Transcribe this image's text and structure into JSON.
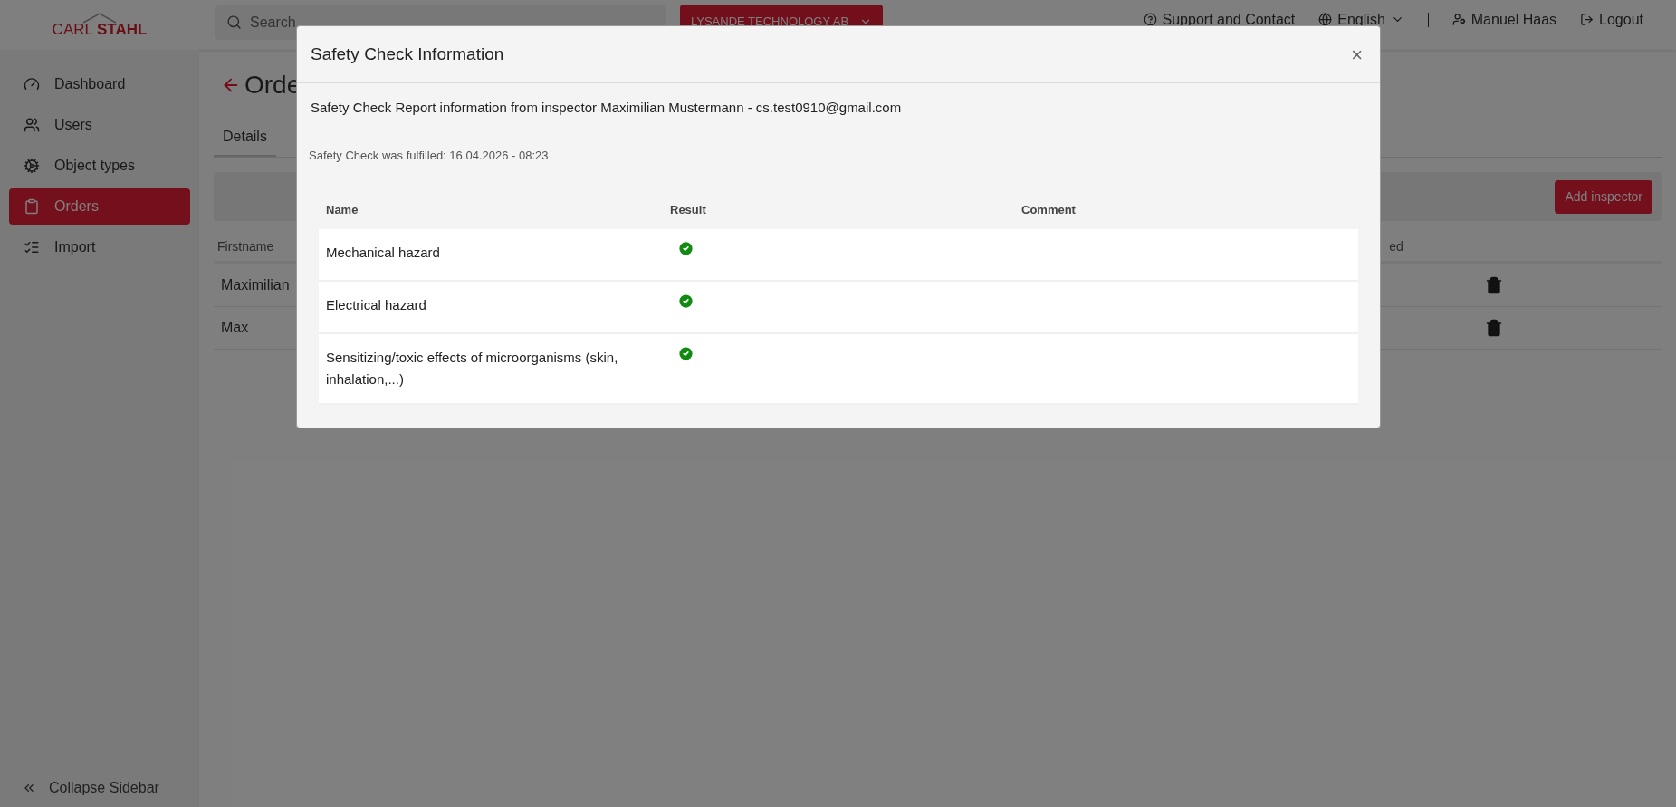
{
  "header": {
    "logo": {
      "first": "CARL",
      "second": "STAHL"
    },
    "search": {
      "placeholder": "Search"
    },
    "company": "LYSANDE TECHNOLOGY AB",
    "links": [
      {
        "label": "Support and Contact"
      },
      {
        "label": "English"
      },
      {
        "label": "Manuel Haas"
      },
      {
        "label": "Logout"
      }
    ]
  },
  "sidebar": {
    "items": [
      {
        "label": "Dashboard",
        "selected": false
      },
      {
        "label": "Users",
        "selected": false
      },
      {
        "label": "Object types",
        "selected": false
      },
      {
        "label": "Orders",
        "selected": true
      },
      {
        "label": "Import",
        "selected": false
      }
    ],
    "collapse": "Collapse Sidebar"
  },
  "page": {
    "title": "Orde",
    "tabs": [
      {
        "label": "Details",
        "selected": true
      }
    ],
    "add_button": "Add inspector",
    "table": {
      "columns": [
        "Firstname",
        "ed"
      ],
      "rows": [
        {
          "firstname": "Maximilian"
        },
        {
          "firstname": "Max"
        }
      ]
    }
  },
  "modal": {
    "title": "Safety Check Information",
    "close": "×",
    "info": "Safety Check Report information from inspector Maximilian Mustermann - cs.test0910@gmail.com",
    "fulfilled": "Safety Check was fulfilled: 16.04.2026 - 08:23",
    "columns": [
      "Name",
      "Result",
      "Comment"
    ],
    "rows": [
      {
        "name": "Mechanical hazard",
        "passed": true
      },
      {
        "name": "Electrical hazard",
        "passed": true
      },
      {
        "name": "Sensitizing/toxic effects of microorganisms (skin, inhalation,...)",
        "passed": true
      }
    ]
  }
}
